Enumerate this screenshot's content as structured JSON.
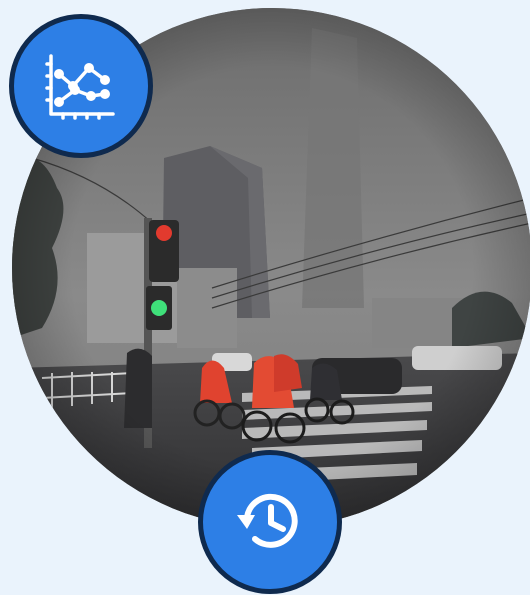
{
  "photo": {
    "subject": "smoggy-city-street-crossing"
  },
  "icons": {
    "chart": "line-chart-icon",
    "history": "history-icon"
  },
  "colors": {
    "page_background": "#eaf3fc",
    "badge_fill": "#2d7fe6",
    "badge_border": "#0f2a4e",
    "icon_stroke": "#ffffff"
  }
}
